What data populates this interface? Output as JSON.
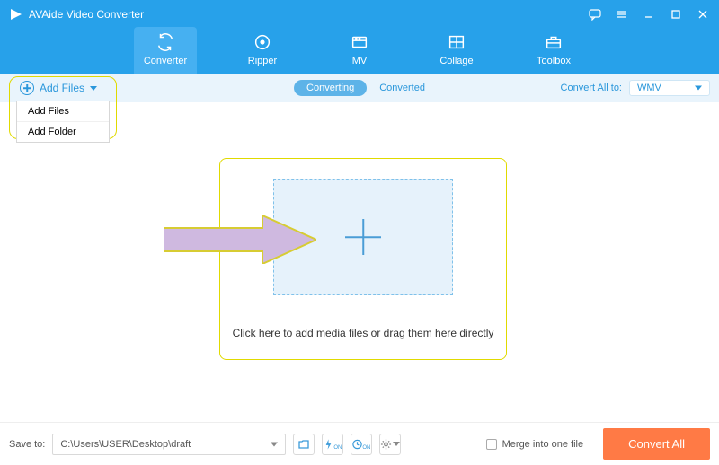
{
  "app_title": "AVAide Video Converter",
  "nav": [
    {
      "id": "converter",
      "label": "Converter"
    },
    {
      "id": "ripper",
      "label": "Ripper"
    },
    {
      "id": "mv",
      "label": "MV"
    },
    {
      "id": "collage",
      "label": "Collage"
    },
    {
      "id": "toolbox",
      "label": "Toolbox"
    }
  ],
  "add_files": {
    "label": "Add Files",
    "menu": [
      "Add Files",
      "Add Folder"
    ]
  },
  "subtabs": {
    "active": "Converting",
    "inactive": "Converted"
  },
  "convert_all_to": {
    "label": "Convert All to:",
    "value": "WMV"
  },
  "drop_text": "Click here to add media files or drag them here directly",
  "footer": {
    "save_label": "Save to:",
    "save_path": "C:\\Users\\USER\\Desktop\\draft",
    "merge_label": "Merge into one file",
    "convert_button": "Convert All"
  }
}
